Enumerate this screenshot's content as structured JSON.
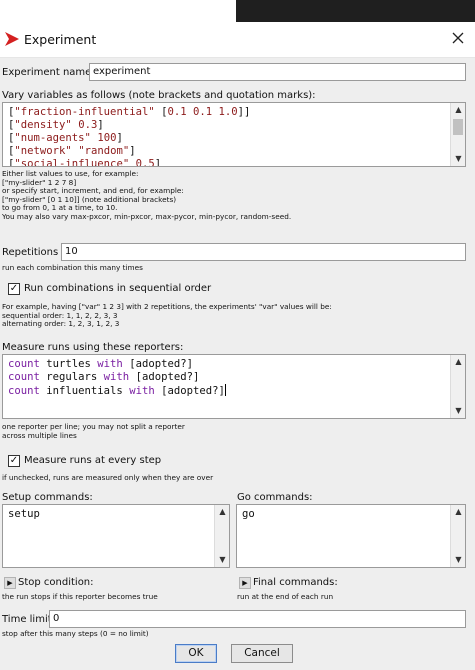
{
  "window": {
    "title": "Experiment",
    "brand_color": "#d42020"
  },
  "experiment_name": {
    "label": "Experiment name",
    "value": "experiment"
  },
  "vary_variables": {
    "label": "Vary variables as follows (note brackets and quotation marks):",
    "lines": [
      [
        "[",
        "\"fraction-influential\"",
        " [",
        "0.1 0.1 1.0",
        "]]"
      ],
      [
        "[",
        "\"density\"",
        " ",
        "0.3",
        "]"
      ],
      [
        "[",
        "\"num-agents\"",
        " ",
        "100",
        "]"
      ],
      [
        "[",
        "\"network\"",
        " ",
        "\"random\"",
        "]"
      ],
      [
        "[",
        "\"social-influence\"",
        " ",
        "0.5",
        "]"
      ]
    ],
    "help": [
      "Either list values to use, for example:",
      "[\"my-slider\" 1 2 7 8]",
      "or specify start, increment, and end, for example:",
      "[\"my-slider\" [0 1 10]] (note additional brackets)",
      "to go from 0, 1 at a time, to 10.",
      "You may also vary max-pxcor, min-pxcor, max-pycor, min-pycor, random-seed."
    ]
  },
  "repetitions": {
    "label": "Repetitions",
    "value": "10",
    "help": "run each combination this many times"
  },
  "sequential": {
    "label": "Run combinations in sequential order",
    "checked": true,
    "help": [
      "For example, having [\"var\" 1 2 3] with 2 repetitions, the experiments' \"var\" values will be:",
      "sequential order: 1, 1, 2, 2, 3, 3",
      "alternating order: 1, 2, 3, 1, 2, 3"
    ]
  },
  "reporters": {
    "label": "Measure runs using these reporters:",
    "lines": [
      [
        "count",
        " turtles ",
        "with",
        " [adopted?]"
      ],
      [
        "count",
        " regulars ",
        "with",
        " [adopted?]"
      ],
      [
        "count",
        " influentials ",
        "with",
        " [adopted?]"
      ]
    ],
    "help": [
      "one reporter per line; you may not split a reporter",
      "across multiple lines"
    ]
  },
  "every_step": {
    "label": "Measure runs at every step",
    "checked": true,
    "help": "if unchecked, runs are measured only when they are over"
  },
  "setup_commands": {
    "label": "Setup commands:",
    "value": "setup"
  },
  "go_commands": {
    "label": "Go commands:",
    "value": "go"
  },
  "stop_condition": {
    "label": "Stop condition:",
    "help": "the run stops if this reporter becomes true"
  },
  "final_commands": {
    "label": "Final commands:",
    "help": "run at the end of each run"
  },
  "time_limit": {
    "label": "Time limit",
    "value": "0",
    "help": "stop after this many steps (0 = no limit)"
  },
  "buttons": {
    "ok": "OK",
    "cancel": "Cancel"
  }
}
